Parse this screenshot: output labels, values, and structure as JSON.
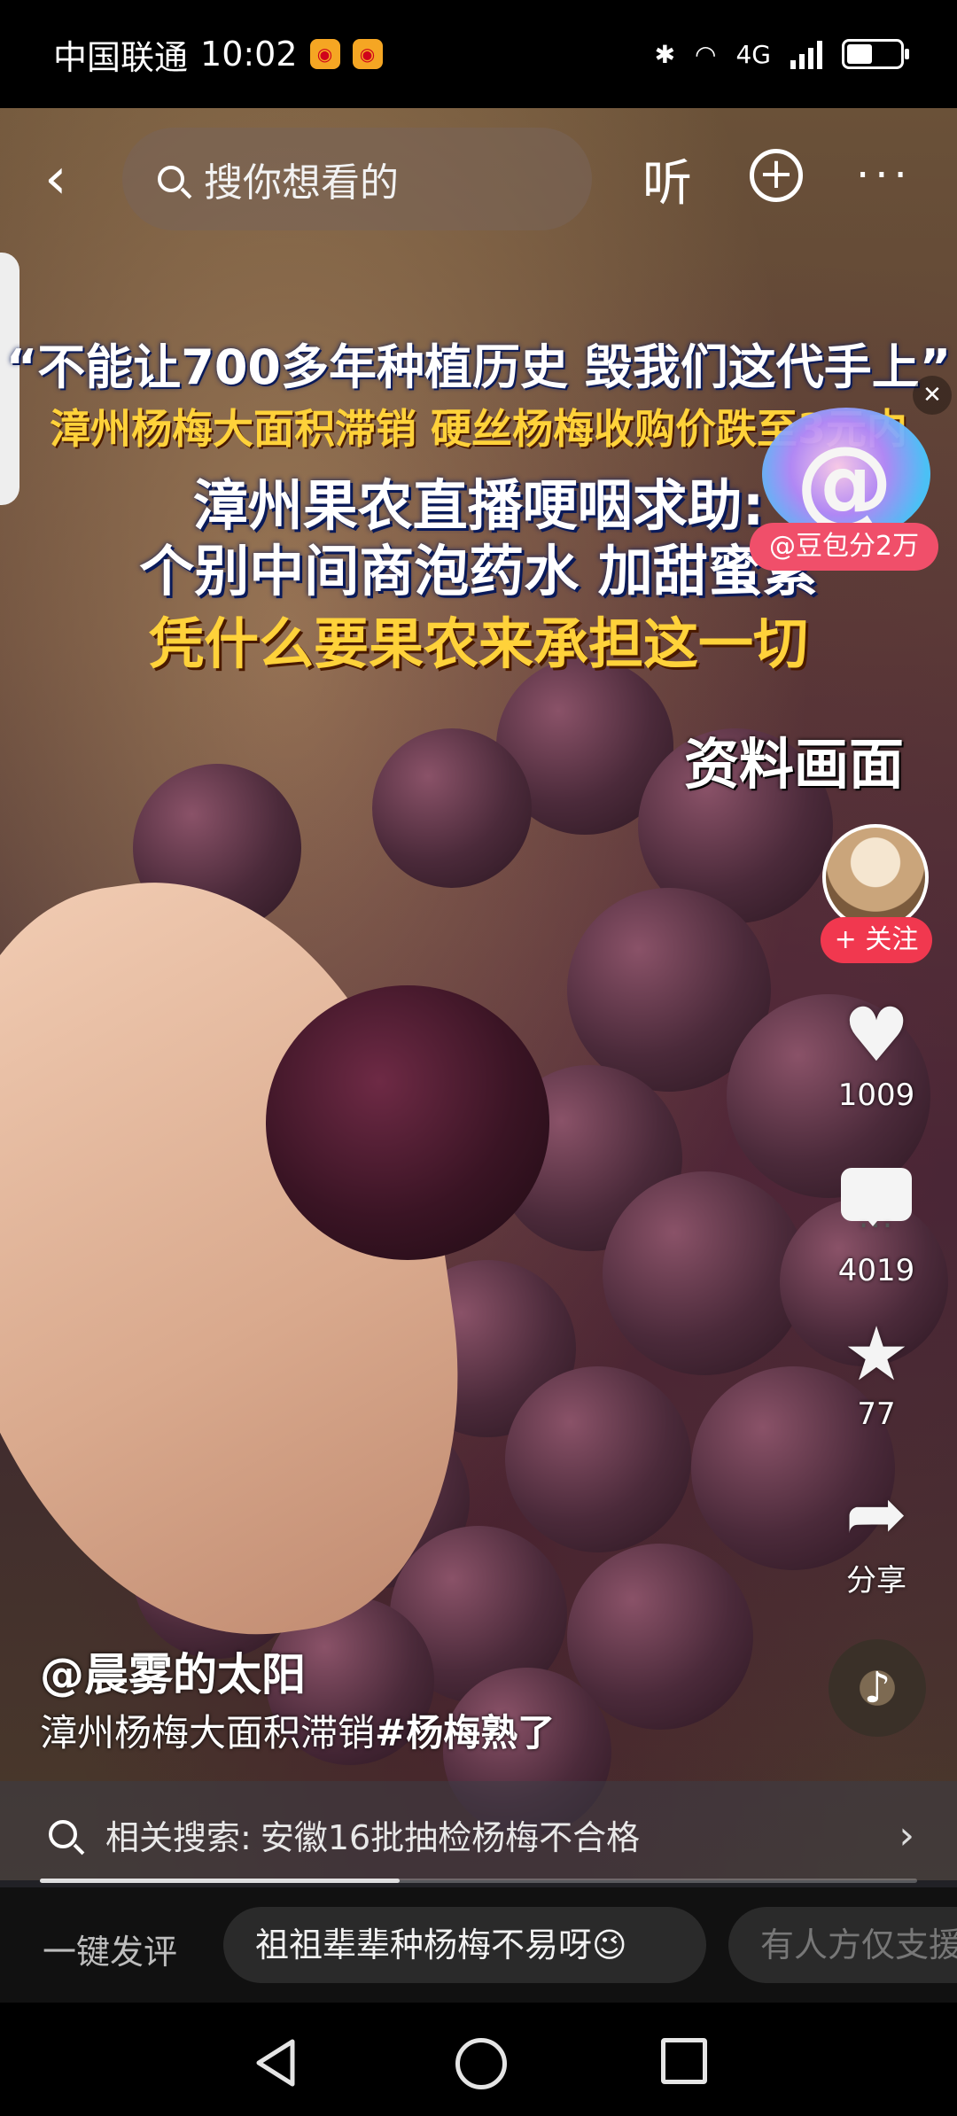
{
  "status_bar": {
    "carrier": "中国联通",
    "time": "10:02",
    "network": "4G"
  },
  "top_nav": {
    "search_placeholder": "搜你想看的",
    "listen_label": "听"
  },
  "video": {
    "caption_line1": "“不能让700多年种植历史 毁我们这代手上”",
    "caption_line2": "漳州杨梅大面积滞销 硬丝杨梅收购价跌至3元内",
    "caption_line3": "漳州果农直播哽咽求助:",
    "caption_line4": "个别中间商泡药水 加甜蜜素",
    "caption_line5": "凭什么要果农来承担这一切",
    "watermark": "资料画面",
    "doubao_tag": "@豆包分2万"
  },
  "sidebar": {
    "follow_label": "+ 关注",
    "likes": "1009",
    "comments": "4019",
    "favorites": "77",
    "share_label": "分享"
  },
  "post": {
    "author": "@晨雾的太阳",
    "description": "漳州杨梅大面积滞销",
    "hashtag": "#杨梅熟了"
  },
  "related": {
    "label": "相关搜索:",
    "query": "安徽16批抽检杨梅不合格"
  },
  "progress": 0.41,
  "comment_bar": {
    "label": "一键发评",
    "suggestions": [
      "祖祖辈辈种杨梅不易呀😉",
      "有人方仅支援"
    ]
  }
}
